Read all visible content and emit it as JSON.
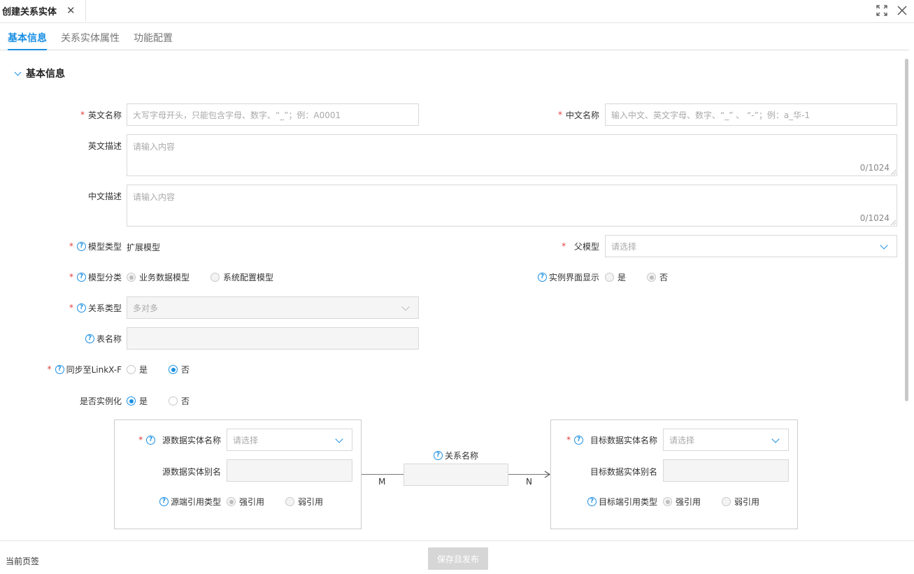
{
  "window": {
    "title": "创建关系实体",
    "close_glyph": "✕",
    "maximize_icon": "maximize-icon",
    "close_icon": "close-icon"
  },
  "tabs": [
    {
      "label": "基本信息",
      "active": true
    },
    {
      "label": "关系实体属性",
      "active": false
    },
    {
      "label": "功能配置",
      "active": false
    }
  ],
  "section": {
    "title": "基本信息"
  },
  "form": {
    "en_name": {
      "label": "英文名称",
      "placeholder": "大写字母开头，只能包含字母、数字、“_”；例：A0001"
    },
    "cn_name": {
      "label": "中文名称",
      "placeholder": "输入中文、英文字母、数字、“_” 、 “-”；例：a_华-1"
    },
    "en_desc": {
      "label": "英文描述",
      "placeholder": "请输入内容",
      "counter": "0/1024"
    },
    "cn_desc": {
      "label": "中文描述",
      "placeholder": "请输入内容",
      "counter": "0/1024"
    },
    "model_type": {
      "label": "模型类型",
      "value": "扩展模型"
    },
    "parent_model": {
      "label": "父模型",
      "placeholder": "请选择"
    },
    "model_category": {
      "label": "模型分类",
      "options": [
        "业务数据模型",
        "系统配置模型"
      ],
      "selected": "业务数据模型"
    },
    "instance_ui": {
      "label": "实例界面显示",
      "options": [
        "是",
        "否"
      ],
      "selected": "否"
    },
    "relation_type": {
      "label": "关系类型",
      "value": "多对多"
    },
    "table_name": {
      "label": "表名称",
      "value": ""
    },
    "sync_linkx": {
      "label": "同步至LinkX-F",
      "options": [
        "是",
        "否"
      ],
      "selected": "否"
    },
    "instantiate": {
      "label": "是否实例化",
      "options": [
        "是",
        "否"
      ],
      "selected": "是"
    }
  },
  "relation": {
    "source": {
      "name_label": "源数据实体名称",
      "name_placeholder": "请选择",
      "alias_label": "源数据实体别名",
      "ref_label": "源端引用类型",
      "ref_options": [
        "强引用",
        "弱引用"
      ],
      "ref_selected": "强引用"
    },
    "middle": {
      "label": "关系名称",
      "left_card": "M",
      "right_card": "N"
    },
    "target": {
      "name_label": "目标数据实体名称",
      "name_placeholder": "请选择",
      "alias_label": "目标数据实体别名",
      "ref_label": "目标端引用类型",
      "ref_options": [
        "强引用",
        "弱引用"
      ],
      "ref_selected": "强引用"
    }
  },
  "footer": {
    "current_tab_label": "当前页签",
    "publish_button": "保存且发布"
  },
  "colors": {
    "accent": "#1a8fe3",
    "required": "#e23c3c",
    "disabled_button": "#d6d6d6"
  }
}
